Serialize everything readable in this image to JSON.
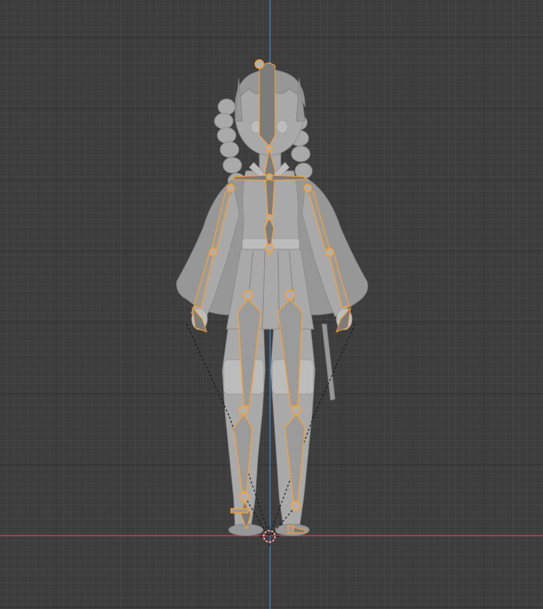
{
  "viewport": {
    "name": "3d-viewport",
    "background": "#3d3d3d",
    "x_axis_color": "#a04450",
    "y_axis_color": "#3f6ea6"
  },
  "scene": {
    "object": "character-mesh",
    "armature": "armature",
    "bone_color": "#ffa029",
    "mesh_color": "#a9a9a9"
  }
}
